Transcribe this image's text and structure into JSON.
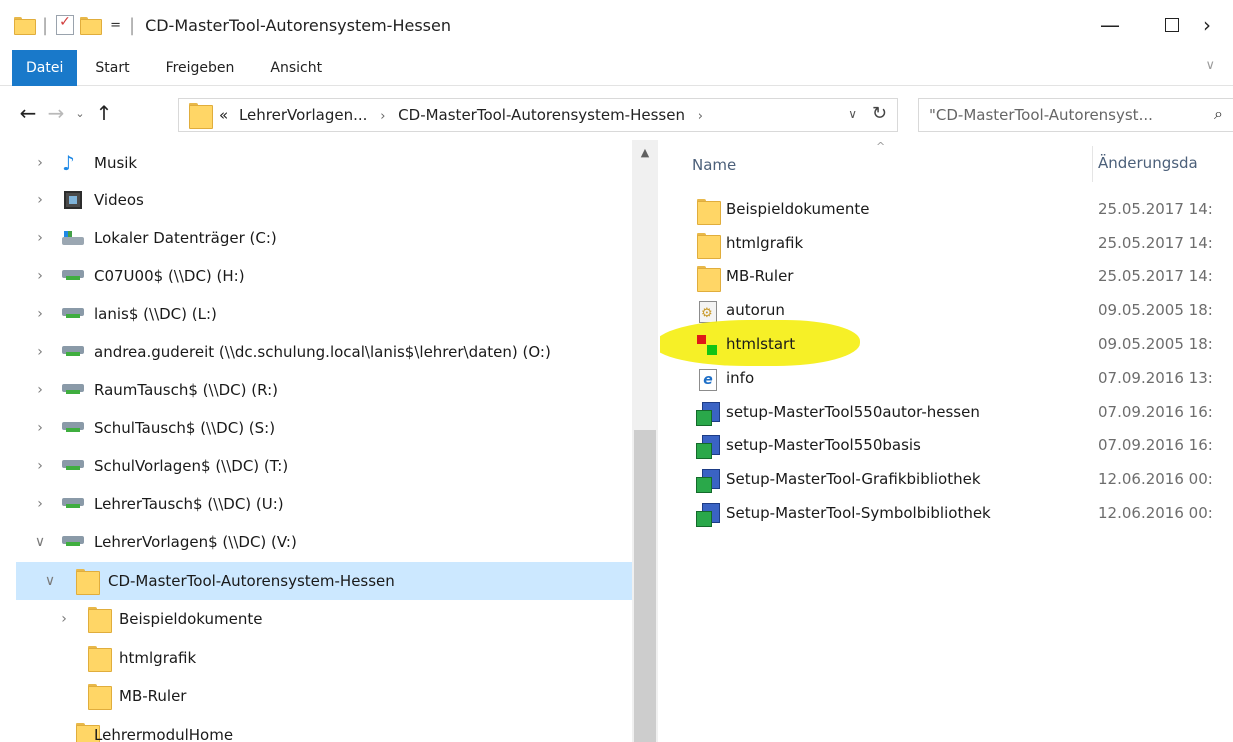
{
  "window": {
    "title": "CD-MasterTool-Autorensystem-Hessen",
    "qat_dropdown": "=",
    "minimize": "—",
    "close": "›"
  },
  "ribbon": {
    "tabs": [
      {
        "label": "Datei",
        "active": true
      },
      {
        "label": "Start"
      },
      {
        "label": "Freigeben"
      },
      {
        "label": "Ansicht"
      }
    ],
    "expand": "∨"
  },
  "addressbar": {
    "prefix": "«",
    "crumbs": [
      "LehrerVorlagen...",
      "CD-MasterTool-Autorensystem-Hessen"
    ],
    "crumb_arrow": "›"
  },
  "search": {
    "placeholder": "\"CD-MasterTool-Autorensyst..."
  },
  "navpane": {
    "items": [
      {
        "label": "Musik",
        "icon": "music-icon",
        "expander": "›"
      },
      {
        "label": "Videos",
        "icon": "video-icon",
        "expander": "›"
      },
      {
        "label": "Lokaler Datenträger (C:)",
        "icon": "local-drive-icon",
        "expander": "›"
      },
      {
        "label": "C07U00$ (\\\\DC) (H:)",
        "icon": "network-drive-icon",
        "expander": "›"
      },
      {
        "label": "lanis$ (\\\\DC) (L:)",
        "icon": "network-drive-icon",
        "expander": "›"
      },
      {
        "label": "andrea.gudereit (\\\\dc.schulung.local\\lanis$\\lehrer\\daten) (O:)",
        "icon": "network-drive-icon",
        "expander": "›"
      },
      {
        "label": "RaumTausch$ (\\\\DC) (R:)",
        "icon": "network-drive-icon",
        "expander": "›"
      },
      {
        "label": "SchulTausch$ (\\\\DC) (S:)",
        "icon": "network-drive-icon",
        "expander": "›"
      },
      {
        "label": "SchulVorlagen$ (\\\\DC) (T:)",
        "icon": "network-drive-icon",
        "expander": "›"
      },
      {
        "label": "LehrerTausch$ (\\\\DC) (U:)",
        "icon": "network-drive-icon",
        "expander": "›"
      },
      {
        "label": "LehrerVorlagen$ (\\\\DC) (V:)",
        "icon": "network-drive-icon",
        "expander": "∨"
      },
      {
        "label": "CD-MasterTool-Autorensystem-Hessen",
        "icon": "folder-icon",
        "expander": "∨",
        "selected": true
      },
      {
        "label": "Beispieldokumente",
        "icon": "folder-icon",
        "expander": "›"
      },
      {
        "label": "htmlgrafik",
        "icon": "folder-icon",
        "expander": ""
      },
      {
        "label": "MB-Ruler",
        "icon": "folder-icon",
        "expander": ""
      },
      {
        "label": "LehrermodulHome",
        "icon": "folder-icon",
        "expander": ""
      }
    ]
  },
  "filelist": {
    "columns": {
      "name": "Name",
      "date": "Änderungsda"
    },
    "rows": [
      {
        "name": "Beispieldokumente",
        "date": "25.05.2017 14:",
        "icon": "folder-icon"
      },
      {
        "name": "htmlgrafik",
        "date": "25.05.2017 14:",
        "icon": "folder-icon"
      },
      {
        "name": "MB-Ruler",
        "date": "25.05.2017 14:",
        "icon": "folder-icon"
      },
      {
        "name": "autorun",
        "date": "09.05.2005 18:",
        "icon": "settings-file-icon"
      },
      {
        "name": "htmlstart",
        "date": "09.05.2005 18:",
        "icon": "htmlstart-app-icon",
        "highlighted": true
      },
      {
        "name": "info",
        "date": "07.09.2016 13:",
        "icon": "ie-html-icon"
      },
      {
        "name": "setup-MasterTool550autor-hessen",
        "date": "07.09.2016 16:",
        "icon": "installer-icon"
      },
      {
        "name": "setup-MasterTool550basis",
        "date": "07.09.2016 16:",
        "icon": "installer-icon"
      },
      {
        "name": "Setup-MasterTool-Grafikbibliothek",
        "date": "12.06.2016 00:",
        "icon": "installer-icon"
      },
      {
        "name": "Setup-MasterTool-Symbolbibliothek",
        "date": "12.06.2016 00:",
        "icon": "installer-icon"
      }
    ]
  },
  "colors": {
    "accent": "#1979ca",
    "selection": "#cce8ff",
    "highlight": "#f6ef1b"
  }
}
